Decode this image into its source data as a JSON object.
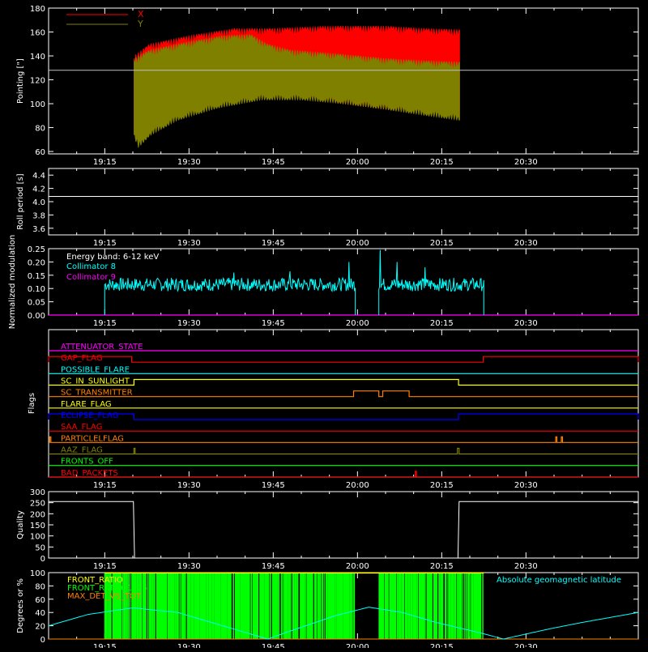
{
  "colors": {
    "axis": "#ffffff",
    "x": "#ff0000",
    "y": "#808000",
    "cyan": "#00ffff",
    "magenta": "#ff00ff",
    "green": "#00ff00",
    "orange": "#ff8000"
  },
  "time_axis": {
    "start_min": 1145,
    "end_min": 1250,
    "tick_labels": [
      "19:15",
      "19:30",
      "19:45",
      "20:00",
      "20:15",
      "20:30"
    ],
    "tick_values": [
      1155,
      1170,
      1185,
      1200,
      1215,
      1230
    ]
  },
  "chart_data": [
    {
      "id": "pointing",
      "type": "area",
      "ylabel": "Pointing [\"]",
      "ylim": [
        58,
        180
      ],
      "yticks": [
        60,
        80,
        100,
        120,
        140,
        160,
        180
      ],
      "hline": 128,
      "data_start_min": 1160.2,
      "data_end_min": 1218.2,
      "series": [
        {
          "name": "X",
          "color": "#ff0000",
          "upper": [
            [
              1160.2,
              140
            ],
            [
              1163,
              150
            ],
            [
              1170,
              157
            ],
            [
              1178,
              163
            ],
            [
              1185,
              163
            ],
            [
              1195,
              165
            ],
            [
              1205,
              165
            ],
            [
              1212,
              163
            ],
            [
              1218,
              162
            ]
          ],
          "lower": [
            [
              1160.2,
              72
            ],
            [
              1161,
              66
            ],
            [
              1163,
              75
            ],
            [
              1168,
              88
            ],
            [
              1175,
              98
            ],
            [
              1183,
              104
            ],
            [
              1190,
              104
            ],
            [
              1197,
              100
            ],
            [
              1205,
              95
            ],
            [
              1212,
              91
            ],
            [
              1218,
              88
            ]
          ]
        },
        {
          "name": "Y",
          "color": "#808000",
          "upper": [
            [
              1160.2,
              138
            ],
            [
              1163,
              145
            ],
            [
              1170,
              152
            ],
            [
              1176,
              157
            ],
            [
              1181,
              158
            ],
            [
              1184,
              150
            ],
            [
              1188,
              145
            ],
            [
              1196,
              142
            ],
            [
              1205,
              138
            ],
            [
              1212,
              136
            ],
            [
              1218,
              135
            ]
          ],
          "lower": [
            [
              1160.2,
              72
            ],
            [
              1161,
              63
            ],
            [
              1163,
              73
            ],
            [
              1168,
              86
            ],
            [
              1175,
              96
            ],
            [
              1183,
              103
            ],
            [
              1190,
              103
            ],
            [
              1197,
              100
            ],
            [
              1205,
              95
            ],
            [
              1212,
              90
            ],
            [
              1218,
              86
            ]
          ]
        }
      ]
    },
    {
      "id": "roll",
      "type": "line",
      "ylabel": "Roll period [s]",
      "ylim": [
        3.5,
        4.5
      ],
      "yticks": [
        3.6,
        3.8,
        4.0,
        4.2,
        4.4
      ],
      "yticklabels": [
        "3.6",
        "3.8",
        "4.0",
        "4.2",
        "4.4"
      ],
      "value": 4.08
    },
    {
      "id": "modulation",
      "type": "line",
      "ylabel": "Normalized modulation",
      "ylim": [
        0,
        0.25
      ],
      "yticks": [
        0,
        0.05,
        0.1,
        0.15,
        0.2,
        0.25
      ],
      "yticklabels": [
        "0.00",
        "0.05",
        "0.10",
        "0.15",
        "0.20",
        "0.25"
      ],
      "annotation": "Energy band: 6-12 keV",
      "series": [
        {
          "name": "Collimator 8",
          "color": "#00ffff",
          "segments": [
            [
              1155,
              1199.6
            ],
            [
              1203.8,
              1222.5
            ]
          ],
          "mean": 0.115,
          "spikes": [
            [
              1198.5,
              0.2
            ],
            [
              1204,
              0.245
            ],
            [
              1207,
              0.2
            ],
            [
              1212,
              0.18
            ],
            [
              1188,
              0.165
            ],
            [
              1178,
              0.16
            ]
          ]
        },
        {
          "name": "Collimator 9",
          "color": "#ff00ff"
        }
      ]
    },
    {
      "id": "flags",
      "type": "table",
      "ylabel": "Flags",
      "rows": [
        {
          "name": "ATTENUATOR_STATE",
          "color": "#ff00ff",
          "high": []
        },
        {
          "name": "GAP_FLAG",
          "color": "#ff0000",
          "high": [
            [
              1145,
              1159.8
            ],
            [
              1222.4,
              1250
            ]
          ]
        },
        {
          "name": "POSSIBLE_FLARE",
          "color": "#00ffff",
          "high": []
        },
        {
          "name": "SC_IN_SUNLIGHT",
          "color": "#ffff00",
          "high": [
            [
              1160.2,
              1218
            ]
          ]
        },
        {
          "name": "SC_TRANSMITTER",
          "color": "#ff8000",
          "high": [
            [
              1199.3,
              1203.8
            ],
            [
              1204.5,
              1209.2
            ]
          ]
        },
        {
          "name": "FLARE_FLAG",
          "color": "#ffff00",
          "high": []
        },
        {
          "name": "ECLIPSE_FLAG",
          "color": "#0000ff",
          "high": [
            [
              1145,
              1160.2
            ],
            [
              1218,
              1250
            ]
          ]
        },
        {
          "name": "SAA_FLAG",
          "color": "#ff0000",
          "high": []
        },
        {
          "name": "PARTICLELFLAG",
          "color": "#ff8000",
          "high": [
            [
              1145.2,
              1145.4
            ],
            [
              1235.3,
              1235.5
            ],
            [
              1236.3,
              1236.5
            ]
          ]
        },
        {
          "name": "AAZ_FLAG",
          "color": "#808000",
          "high": [
            [
              1160.2,
              1160.4
            ],
            [
              1217.8,
              1218.1
            ]
          ]
        },
        {
          "name": "FRONTS_OFF",
          "color": "#00ff00",
          "high": []
        },
        {
          "name": "BAD_PACKETS",
          "color": "#ff0000",
          "high": [
            [
              1210.3,
              1210.5
            ]
          ]
        }
      ]
    },
    {
      "id": "quality",
      "type": "line",
      "ylabel": "Quality",
      "ylim": [
        0,
        300
      ],
      "yticks": [
        0,
        50,
        100,
        150,
        200,
        250,
        300
      ],
      "yticklabels": [
        "0",
        "50",
        "100",
        "150",
        "200",
        "250",
        "300"
      ],
      "points": [
        [
          1145,
          255
        ],
        [
          1160.1,
          255
        ],
        [
          1160.3,
          0
        ],
        [
          1217.9,
          0
        ],
        [
          1218.1,
          255
        ],
        [
          1250,
          255
        ]
      ]
    },
    {
      "id": "lat",
      "type": "line",
      "ylabel": "Degrees or %",
      "ylim": [
        0,
        100
      ],
      "yticks": [
        0,
        20,
        40,
        60,
        80,
        100
      ],
      "yticklabels": [
        "0",
        "20",
        "40",
        "60",
        "80",
        "100"
      ],
      "legend": [
        {
          "name": "FRONT_RATIO",
          "color": "#ffff00"
        },
        {
          "name": "FRONT_RATIO_1225",
          "color": "#00ff00"
        },
        {
          "name": "MAX_DET_VS_TOT",
          "color": "#ff8000"
        }
      ],
      "right_label": "Absolute geomagnetic latitude",
      "green_range": [
        1155,
        1222.5
      ],
      "latitude": [
        [
          1145,
          20
        ],
        [
          1152,
          37
        ],
        [
          1160,
          47
        ],
        [
          1168,
          40
        ],
        [
          1176,
          20
        ],
        [
          1182,
          5
        ],
        [
          1184,
          0
        ],
        [
          1188,
          12
        ],
        [
          1196,
          35
        ],
        [
          1202,
          48
        ],
        [
          1208,
          40
        ],
        [
          1214,
          25
        ],
        [
          1222,
          9
        ],
        [
          1226,
          0
        ],
        [
          1234,
          15
        ],
        [
          1240,
          25
        ],
        [
          1250,
          40
        ]
      ]
    }
  ]
}
